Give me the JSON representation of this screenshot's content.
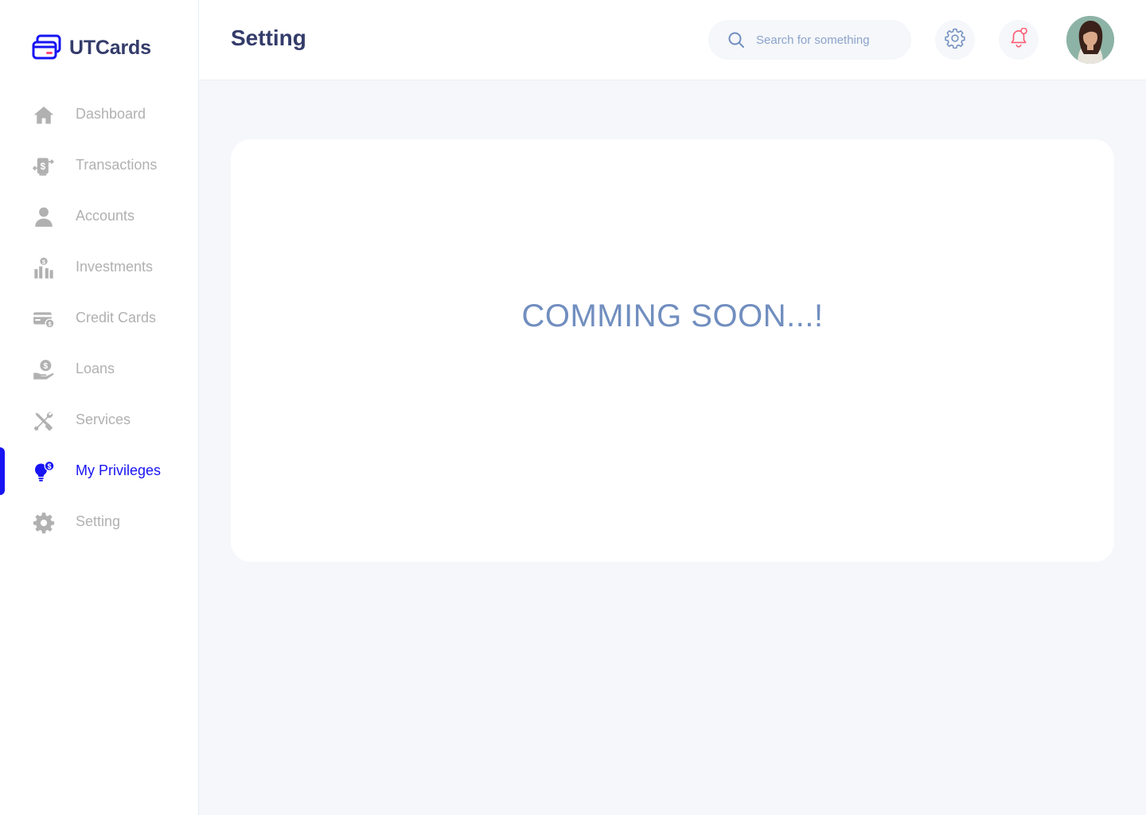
{
  "app": {
    "name": "UTCards"
  },
  "colors": {
    "primary": "#1814F3",
    "title": "#343C6A",
    "muted": "#B1B1B1",
    "accent_text": "#718EBF",
    "notification": "#FE5C73"
  },
  "sidebar": {
    "items": [
      {
        "label": "Dashboard",
        "icon": "home-icon",
        "active": false
      },
      {
        "label": "Transactions",
        "icon": "transfer-icon",
        "active": false
      },
      {
        "label": "Accounts",
        "icon": "user-icon",
        "active": false
      },
      {
        "label": "Investments",
        "icon": "investment-icon",
        "active": false
      },
      {
        "label": "Credit Cards",
        "icon": "credit-card-icon",
        "active": false
      },
      {
        "label": "Loans",
        "icon": "loan-icon",
        "active": false
      },
      {
        "label": "Services",
        "icon": "services-icon",
        "active": false
      },
      {
        "label": "My Privileges",
        "icon": "privileges-icon",
        "active": true
      },
      {
        "label": "Setting",
        "icon": "gear-icon",
        "active": false
      }
    ]
  },
  "header": {
    "title": "Setting",
    "search_placeholder": "Search for something",
    "settings_icon": "gear-icon",
    "notification_icon": "bell-icon",
    "avatar": "avatar"
  },
  "main": {
    "message": "COMMING SOON...!"
  }
}
